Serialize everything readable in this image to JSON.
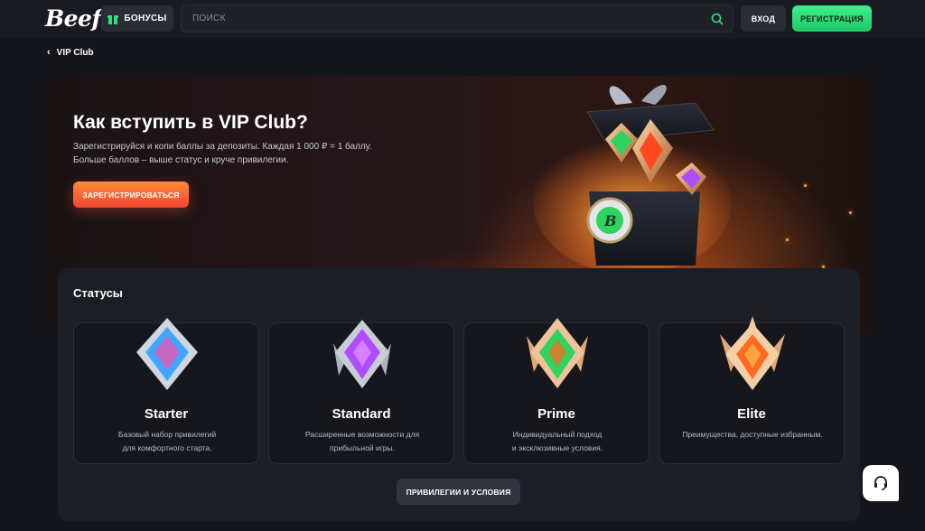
{
  "header": {
    "logo": "Beef",
    "bonus_label": "БОНУСЫ",
    "search_placeholder": "ПОИСК",
    "login_label": "ВХОД",
    "register_label": "РЕГИСТРАЦИЯ"
  },
  "breadcrumb": {
    "back_label": "VIP Club"
  },
  "hero": {
    "title": "Как вступить в VIP Club?",
    "subtitle_line1": "Зарегистрируйся и копи баллы за депозиты. Каждая 1 000 ₽ = 1 баллу.",
    "subtitle_line2": "Больше баллов – выше статус и круче привилегии.",
    "cta_label": "ЗАРЕГИСТРИРОВАТЬСЯ"
  },
  "statuses": {
    "title": "Статусы",
    "cards": [
      {
        "name": "Starter",
        "desc_line1": "Базовый набор привилегий",
        "desc_line2": "для комфортного старта.",
        "gem_color": "#3fa7ff"
      },
      {
        "name": "Standard",
        "desc_line1": "Расширенные возможности для",
        "desc_line2": "прибыльной игры.",
        "gem_color": "#b04cff"
      },
      {
        "name": "Prime",
        "desc_line1": "Индивидуальный подход",
        "desc_line2": "и эксклюзивные условия.",
        "gem_color": "#2fd35f"
      },
      {
        "name": "Elite",
        "desc_line1": "Преимущества, доступные избранным.",
        "desc_line2": "",
        "gem_color": "#ff6a1f"
      }
    ],
    "privileges_label": "ПРИВИЛЕГИИ И УСЛОВИЯ"
  },
  "colors": {
    "accent_green": "#2ee57d",
    "accent_orange": "#f2462f",
    "background": "#14161c"
  },
  "icons": [
    "gift-icon",
    "search-icon",
    "chevron-left-icon",
    "headset-icon"
  ]
}
